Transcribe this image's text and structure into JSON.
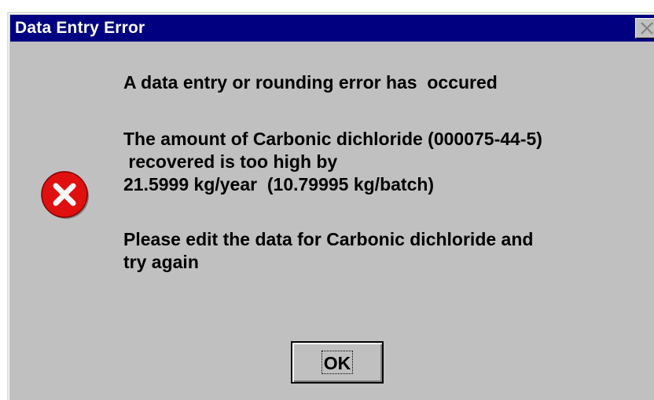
{
  "window": {
    "title": "Data Entry Error",
    "close_icon": "close-icon"
  },
  "icon": {
    "name": "error-icon",
    "color": "#e01010"
  },
  "message": {
    "line1": "A data entry or rounding error has  occured",
    "block2": "The amount of Carbonic dichloride (000075-44-5)\n recovered is too high by\n21.5999 kg/year  (10.79995 kg/batch)",
    "block3": "Please edit the data for Carbonic dichloride and\ntry again"
  },
  "buttons": {
    "ok_label": "OK"
  },
  "colors": {
    "titlebar": "#000080",
    "dialog_bg": "#c0c0c0"
  }
}
